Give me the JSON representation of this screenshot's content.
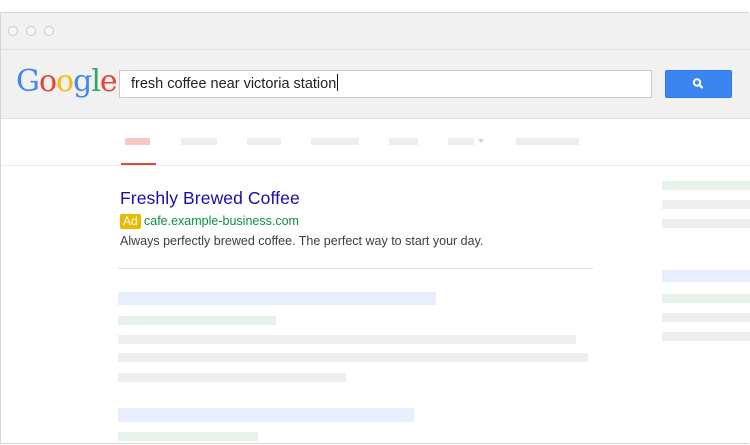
{
  "window": {
    "controls": [
      "close",
      "minimize",
      "maximize"
    ]
  },
  "logo": {
    "letters": [
      {
        "char": "G",
        "color": "#4285F4"
      },
      {
        "char": "o",
        "color": "#EA4335"
      },
      {
        "char": "o",
        "color": "#FBBC05"
      },
      {
        "char": "g",
        "color": "#4285F4"
      },
      {
        "char": "l",
        "color": "#34A853"
      },
      {
        "char": "e",
        "color": "#EA4335"
      }
    ]
  },
  "search": {
    "query": "fresh coffee near victoria station",
    "button_icon": "search-icon"
  },
  "tabs": [
    {
      "active": true
    },
    {
      "active": false
    },
    {
      "active": false
    },
    {
      "active": false
    },
    {
      "active": false
    },
    {
      "active": false,
      "has_dropdown": true
    },
    {
      "active": false
    }
  ],
  "ad": {
    "title": "Freshly Brewed Coffee",
    "badge": "Ad",
    "url": "cafe.example-business.com",
    "description": "Always perfectly brewed coffee. The perfect way to start your day."
  },
  "colors": {
    "link": "#1a0dab",
    "url_green": "#0d8f3c",
    "ad_badge": "#edb802",
    "search_button": "#3b85f0",
    "active_tab": "#dd4b39"
  }
}
